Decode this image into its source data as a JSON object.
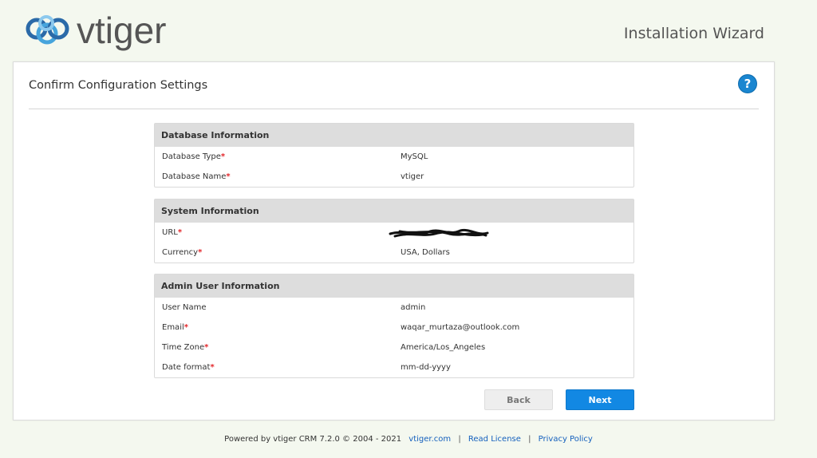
{
  "header": {
    "logo_text": "vtiger",
    "wizard_title": "Installation Wizard"
  },
  "panel": {
    "heading": "Confirm Configuration Settings",
    "help_icon": "?"
  },
  "database": {
    "title": "Database Information",
    "type_label": "Database Type",
    "type_value": "MySQL",
    "name_label": "Database Name",
    "name_value": "vtiger"
  },
  "system": {
    "title": "System Information",
    "url_label": "URL",
    "currency_label": "Currency",
    "currency_value": "USA, Dollars"
  },
  "admin": {
    "title": "Admin User Information",
    "username_label": "User Name",
    "username_value": "admin",
    "email_label": "Email",
    "email_value": "waqar_murtaza@outlook.com",
    "timezone_label": "Time Zone",
    "timezone_value": "America/Los_Angeles",
    "dateformat_label": "Date format",
    "dateformat_value": "mm-dd-yyyy"
  },
  "required_marker": "*",
  "buttons": {
    "back": "Back",
    "next": "Next"
  },
  "footer": {
    "powered": "Powered by vtiger CRM 7.2.0  © 2004 - 2021",
    "link_site": "vtiger.com",
    "sep1": "|",
    "link_license": "Read License",
    "sep2": "|",
    "link_privacy": "Privacy Policy"
  },
  "colors": {
    "accent": "#1288e3",
    "required": "#e3262a",
    "background": "#f4f8ef"
  }
}
